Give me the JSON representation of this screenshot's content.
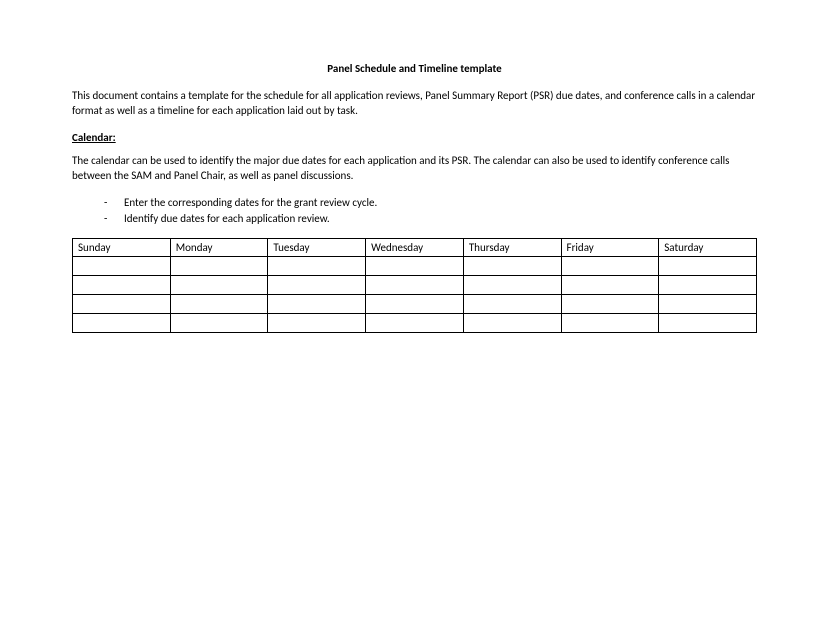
{
  "title": "Panel Schedule and Timeline template",
  "intro": "This document contains a template for the schedule for all application reviews, Panel Summary Report (PSR) due dates, and conference calls in a calendar format as well as a timeline for each application laid out by task.",
  "calendar_heading": "Calendar:",
  "calendar_desc": "The calendar can be used to identify the major due dates for each application and its PSR.  The calendar can also be used to identify conference calls between the SAM and Panel Chair, as well as panel discussions.",
  "bullets": [
    "Enter the corresponding dates for the grant review cycle.",
    "Identify due dates for each application review."
  ],
  "days": [
    "Sunday",
    "Monday",
    "Tuesday",
    "Wednesday",
    "Thursday",
    "Friday",
    "Saturday"
  ]
}
